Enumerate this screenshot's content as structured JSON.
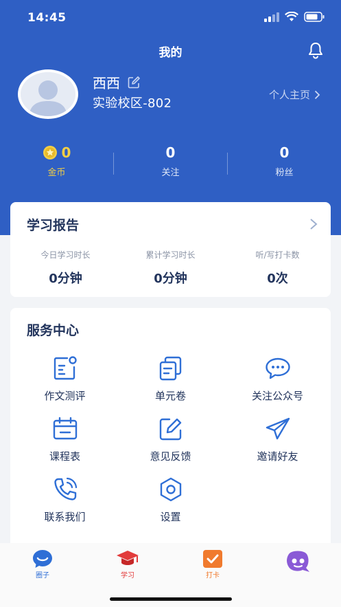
{
  "status_bar": {
    "time": "14:45"
  },
  "nav": {
    "title": "我的"
  },
  "profile": {
    "name": "西西",
    "school": "实验校区-802",
    "homepage_link": "个人主页"
  },
  "stats": [
    {
      "value": "0",
      "label": "金币"
    },
    {
      "value": "0",
      "label": "关注"
    },
    {
      "value": "0",
      "label": "粉丝"
    }
  ],
  "report": {
    "title": "学习报告",
    "items": [
      {
        "label": "今日学习时长",
        "value": "0分钟"
      },
      {
        "label": "累计学习时长",
        "value": "0分钟"
      },
      {
        "label": "听/写打卡数",
        "value": "0次"
      }
    ]
  },
  "services": {
    "title": "服务中心",
    "items": [
      {
        "label": "作文测评",
        "icon": "essay-review-icon"
      },
      {
        "label": "单元卷",
        "icon": "unit-paper-icon"
      },
      {
        "label": "关注公众号",
        "icon": "chat-bubble-icon"
      },
      {
        "label": "课程表",
        "icon": "calendar-icon"
      },
      {
        "label": "意见反馈",
        "icon": "feedback-edit-icon"
      },
      {
        "label": "邀请好友",
        "icon": "paper-plane-icon"
      },
      {
        "label": "联系我们",
        "icon": "phone-icon"
      },
      {
        "label": "设置",
        "icon": "settings-hexagon-icon"
      }
    ]
  },
  "tabbar": {
    "items": [
      {
        "label": "圈子",
        "color": "#2f6fd6",
        "icon": "chat-circle-icon"
      },
      {
        "label": "学习",
        "color": "#e23b3b",
        "icon": "graduation-cap-icon"
      },
      {
        "label": "打卡",
        "color": "#f07a2d",
        "icon": "checkbox-icon"
      },
      {
        "label": "",
        "color": "#8a5ad6",
        "icon": "robot-mascot-icon"
      }
    ]
  },
  "colors": {
    "primary": "#2f5fc4",
    "gold": "#f3cf45",
    "text_dark": "#22345c"
  }
}
